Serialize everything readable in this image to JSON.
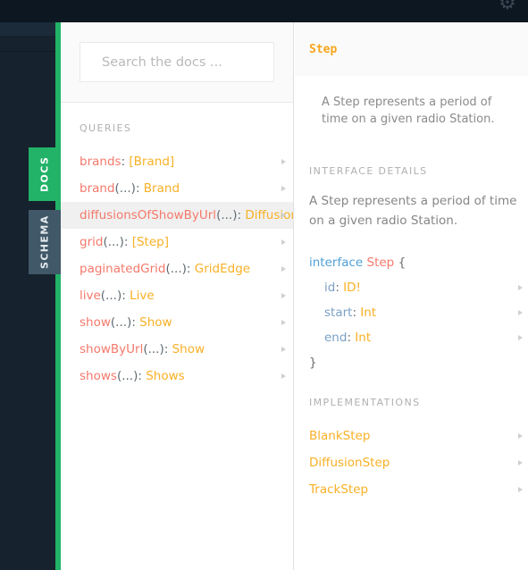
{
  "topbar": {
    "gear_icon": "gear-icon",
    "gear_glyph": "⚙"
  },
  "rail": {
    "tabs": [
      {
        "label": "DOCS",
        "active": true
      },
      {
        "label": "SCHEMA",
        "active": false
      }
    ]
  },
  "colors": {
    "accent_green": "#22b268",
    "header_dark": "#0d1721",
    "rail_dark": "#16222e",
    "schema_tab": "#415868",
    "field_name_red": "#f4796b",
    "type_orange": "#f8b026",
    "title_orange": "#f8a51b",
    "keyword_blue": "#50a0d8",
    "arg_gray": "#5d6a72",
    "selected_row": "#f0f0f0"
  },
  "docs_panel": {
    "search": {
      "placeholder": "Search the docs ...",
      "value": ""
    },
    "queries_label": "QUERIES",
    "queries": [
      {
        "name": "brands",
        "args": "",
        "colon": ": ",
        "type": "[Brand]",
        "selected": false
      },
      {
        "name": "brand",
        "args": "(...)",
        "colon": ": ",
        "type": "Brand",
        "selected": false
      },
      {
        "name": "diffusionsOfShowByUrl",
        "args": "(...)",
        "colon": ": ",
        "type": "Diffusions",
        "selected": true
      },
      {
        "name": "grid",
        "args": "(...)",
        "colon": ": ",
        "type": "[Step]",
        "selected": false
      },
      {
        "name": "paginatedGrid",
        "args": "(...)",
        "colon": ": ",
        "type": "GridEdge",
        "selected": false
      },
      {
        "name": "live",
        "args": "(...)",
        "colon": ": ",
        "type": "Live",
        "selected": false
      },
      {
        "name": "show",
        "args": "(...)",
        "colon": ": ",
        "type": "Show",
        "selected": false
      },
      {
        "name": "showByUrl",
        "args": "(...)",
        "colon": ": ",
        "type": "Show",
        "selected": false
      },
      {
        "name": "shows",
        "args": "(...)",
        "colon": ": ",
        "type": "Shows",
        "selected": false
      }
    ]
  },
  "detail_panel": {
    "title": "Step",
    "description": "A Step represents a period of time on a given radio Station.",
    "interface_details_label": "INTERFACE DETAILS",
    "interface_description": "A Step represents a period of time on a given radio Station.",
    "code": {
      "keyword": "interface",
      "type_name": "Step",
      "open_brace": "{",
      "close_brace": "}",
      "fields": [
        {
          "name": "id",
          "colon": ": ",
          "type": "ID!"
        },
        {
          "name": "start",
          "colon": ": ",
          "type": "Int"
        },
        {
          "name": "end",
          "colon": ": ",
          "type": "Int"
        }
      ]
    },
    "implementations_label": "IMPLEMENTATIONS",
    "implementations": [
      {
        "name": "BlankStep"
      },
      {
        "name": "DiffusionStep"
      },
      {
        "name": "TrackStep"
      }
    ]
  }
}
